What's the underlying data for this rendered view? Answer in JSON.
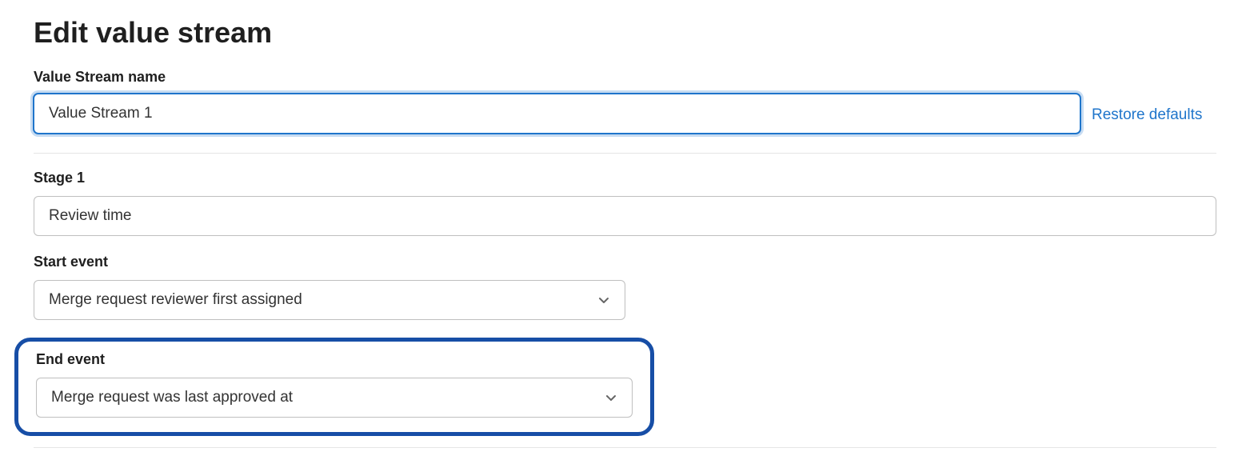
{
  "page": {
    "title": "Edit value stream"
  },
  "nameField": {
    "label": "Value Stream name",
    "value": "Value Stream 1"
  },
  "restoreLink": {
    "label": "Restore defaults"
  },
  "stage": {
    "label": "Stage 1",
    "value": "Review time"
  },
  "startEvent": {
    "label": "Start event",
    "value": "Merge request reviewer first assigned"
  },
  "endEvent": {
    "label": "End event",
    "value": "Merge request was last approved at"
  }
}
